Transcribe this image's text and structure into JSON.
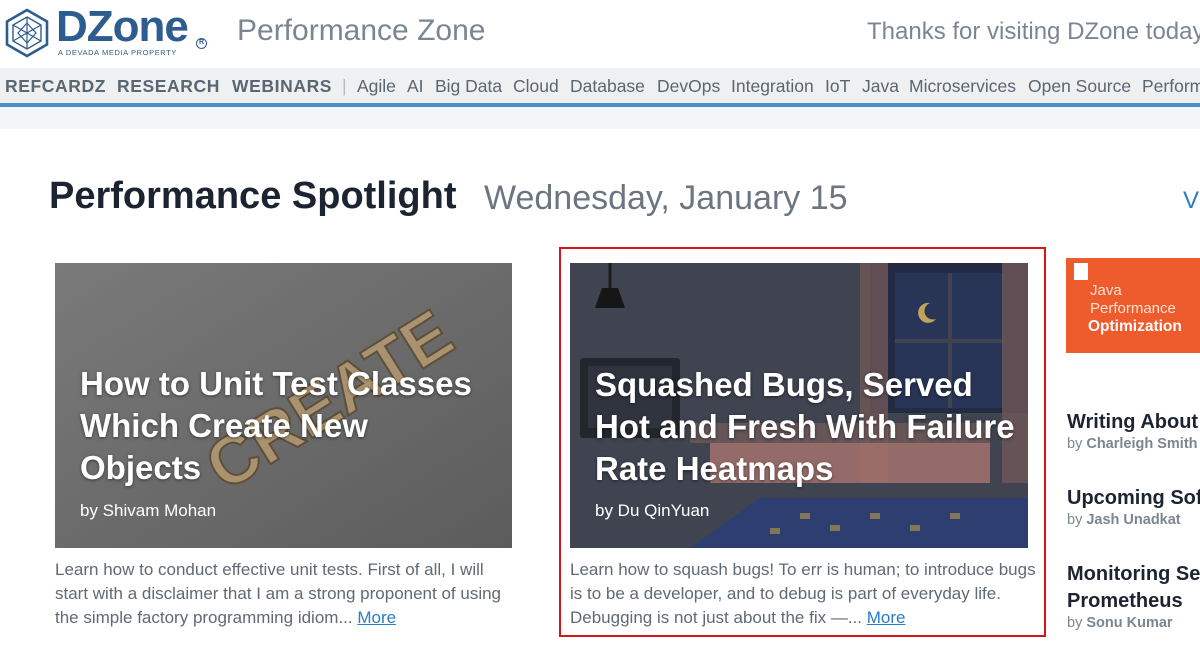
{
  "header": {
    "logo_text": "DZone",
    "logo_tagline": "A DEVADA MEDIA PROPERTY",
    "zone_title": "Performance Zone",
    "greeting": "Thanks for visiting DZone today"
  },
  "nav": {
    "primary": [
      "REFCARDZ",
      "RESEARCH",
      "WEBINARS"
    ],
    "separator": "|",
    "topics": [
      "Agile",
      "AI",
      "Big Data",
      "Cloud",
      "Database",
      "DevOps",
      "Integration",
      "IoT",
      "Java",
      "Microservices",
      "Open Source",
      "Perform"
    ]
  },
  "spotlight": {
    "title": "Performance Spotlight",
    "date": "Wednesday, January 15",
    "view_all": "Vi"
  },
  "cards": [
    {
      "title": "How to Unit Test Classes Which Create New Objects",
      "author": "by Shivam Mohan",
      "description": "Learn how to conduct effective unit tests. First of all, I will start with a disclaimer that I am a strong proponent of using the simple factory programming idiom...",
      "more": "More",
      "image_text": "CREATE"
    },
    {
      "title": "Squashed Bugs, Served Hot and Fresh With Failure Rate Heatmaps",
      "author": "by Du QinYuan",
      "description": "Learn how to squash bugs! To err is human; to introduce bugs is to be a developer, and to debug is part of everyday life. Debugging is not just about the fix —...",
      "more": "More"
    }
  ],
  "refcard": {
    "line1": "Java",
    "line2": "Performance",
    "line3": "Optimization"
  },
  "sidebar": [
    {
      "title": "Writing About",
      "author_prefix": "by ",
      "author": "Charleigh Smith"
    },
    {
      "title": "Upcoming Sof",
      "author_prefix": "by ",
      "author": "Jash Unadkat"
    },
    {
      "title": "Monitoring Se",
      "title2": "Prometheus",
      "author_prefix": "by ",
      "author": "Sonu Kumar"
    }
  ],
  "colors": {
    "brand": "#2d5c8f",
    "link": "#2a7cc4",
    "highlight_border": "#d1171c",
    "refcard_bg": "#ee5b2c"
  }
}
